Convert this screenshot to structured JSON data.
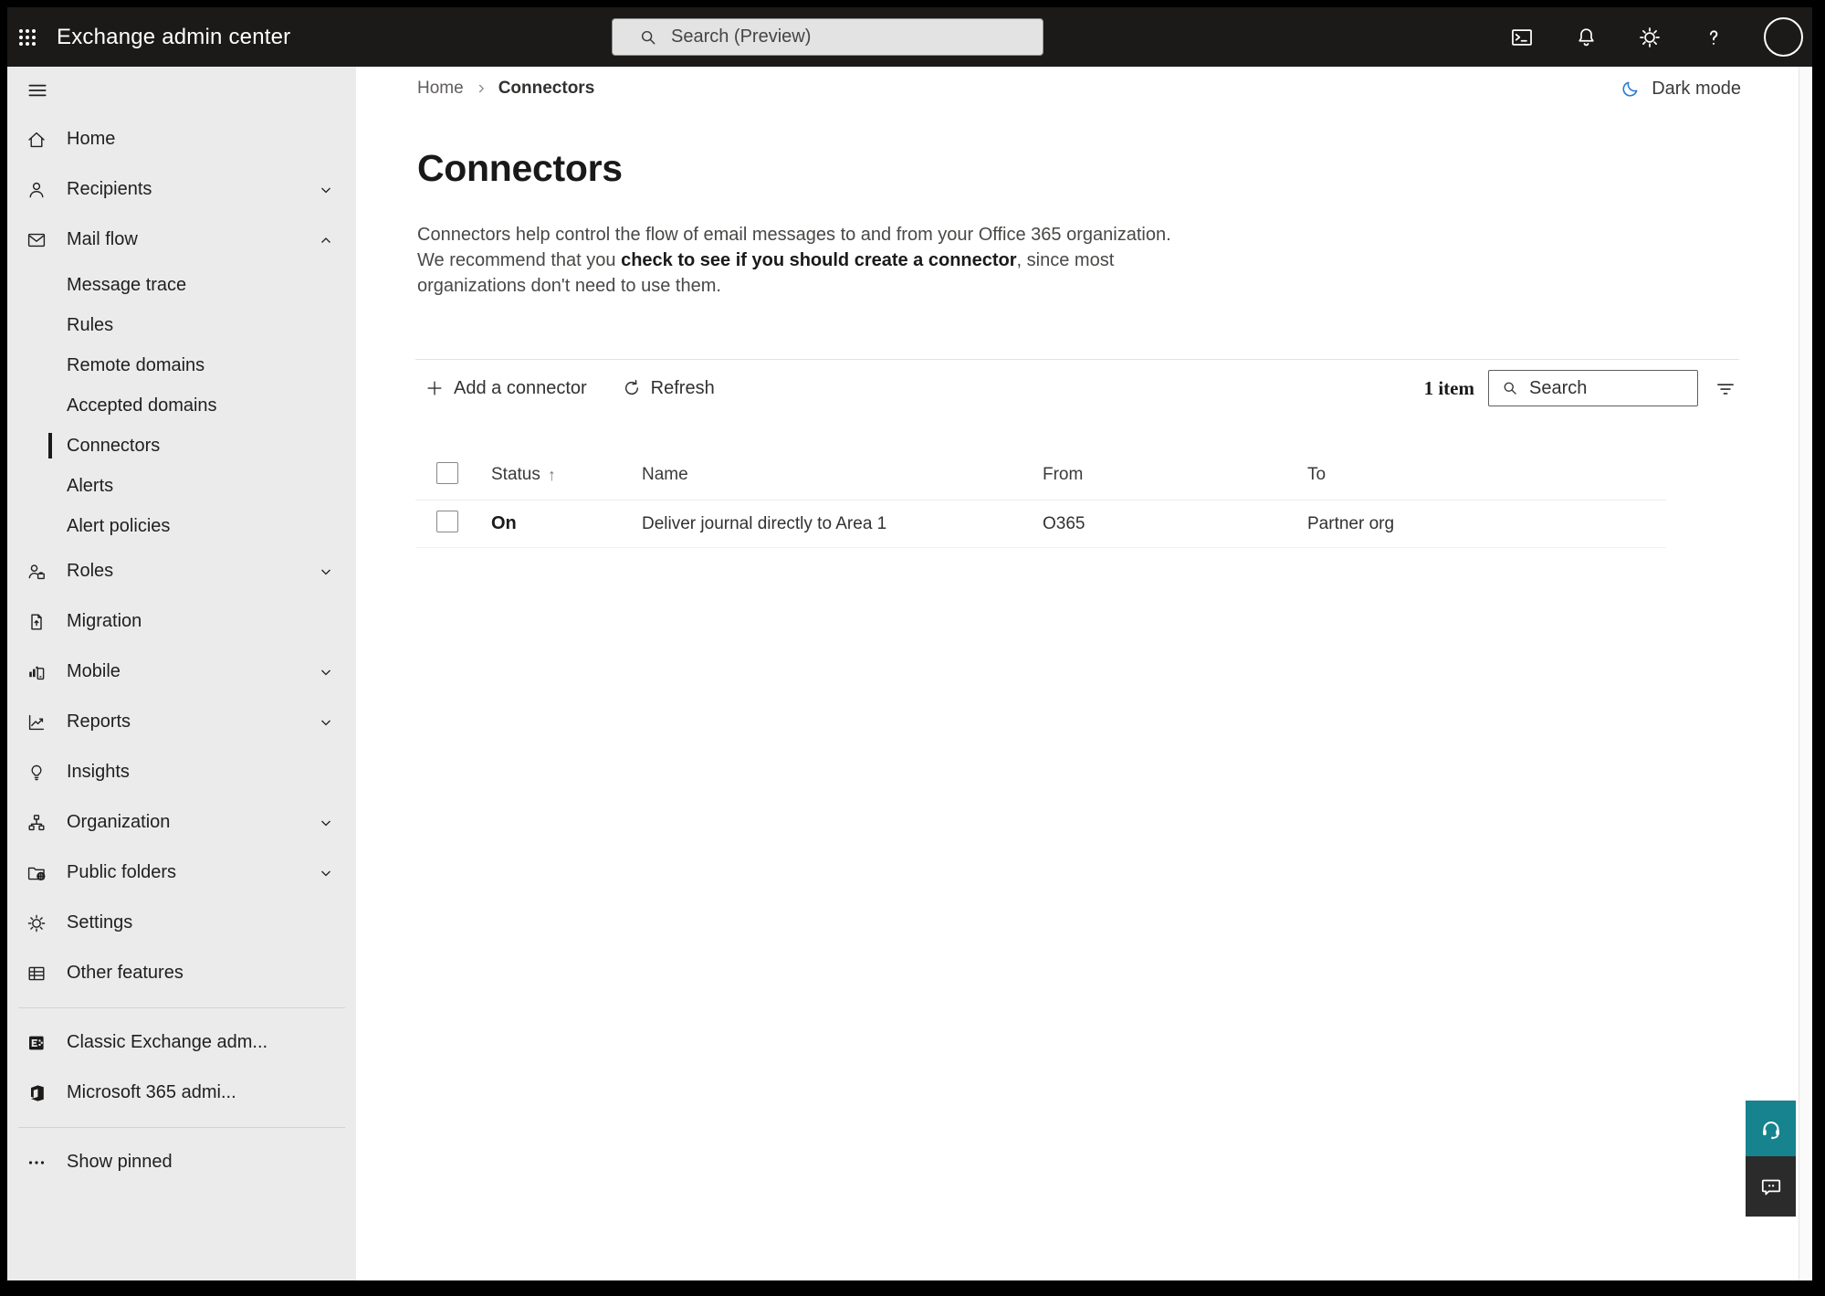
{
  "colors": {
    "topbar_bg": "#1b1a19",
    "sidebar_bg": "#ebebeb",
    "accent_blue": "#2b7cd3",
    "help_button_teal": "#16838e",
    "feedback_button_dark": "#2b2b2b",
    "selected_marker": "#1b1a19"
  },
  "topbar": {
    "title": "Exchange admin center",
    "search_placeholder": "Search (Preview)",
    "icons": [
      "app-launcher",
      "powershell-terminal",
      "notifications-bell",
      "settings-gear",
      "help-question",
      "account-avatar"
    ]
  },
  "sidebar": {
    "items": [
      {
        "label": "Home",
        "icon": "home"
      },
      {
        "label": "Recipients",
        "icon": "person",
        "chevron": "down"
      },
      {
        "label": "Mail flow",
        "icon": "mail",
        "chevron": "up",
        "expanded": true
      },
      {
        "label": "Roles",
        "icon": "person-badge",
        "chevron": "down"
      },
      {
        "label": "Migration",
        "icon": "document-arrow"
      },
      {
        "label": "Mobile",
        "icon": "mobile-chart",
        "chevron": "down"
      },
      {
        "label": "Reports",
        "icon": "line-chart",
        "chevron": "down"
      },
      {
        "label": "Insights",
        "icon": "lightbulb"
      },
      {
        "label": "Organization",
        "icon": "org-chart",
        "chevron": "down"
      },
      {
        "label": "Public folders",
        "icon": "folder-globe",
        "chevron": "down"
      },
      {
        "label": "Settings",
        "icon": "gear"
      },
      {
        "label": "Other features",
        "icon": "table-grid"
      }
    ],
    "mail_flow_children": [
      {
        "label": "Message trace"
      },
      {
        "label": "Rules"
      },
      {
        "label": "Remote domains"
      },
      {
        "label": "Accepted domains"
      },
      {
        "label": "Connectors",
        "selected": true
      },
      {
        "label": "Alerts"
      },
      {
        "label": "Alert policies"
      }
    ],
    "footer_links": [
      {
        "label": "Classic Exchange adm...",
        "icon": "exchange-logo"
      },
      {
        "label": "Microsoft 365 admi...",
        "icon": "microsoft-365-logo"
      }
    ],
    "show_pinned_label": "Show pinned"
  },
  "breadcrumb": {
    "items": [
      "Home",
      "Connectors"
    ]
  },
  "dark_mode": {
    "label": "Dark mode",
    "icon": "moon"
  },
  "page": {
    "title": "Connectors",
    "description_before": "Connectors help control the flow of email messages to and from your Office 365 organization. We recommend that you ",
    "description_link": "check to see if you should create a connector",
    "description_after": ", since most organizations don't need to use them."
  },
  "toolbar": {
    "add_label": "Add a connector",
    "refresh_label": "Refresh",
    "item_count": "1 item",
    "search_placeholder": "Search"
  },
  "table": {
    "columns": [
      "Status",
      "Name",
      "From",
      "To"
    ],
    "sort_indicator": "↑",
    "sort": {
      "column": "Status",
      "direction": "ascending"
    },
    "rows": [
      {
        "selected": false,
        "status": "On",
        "name": "Deliver journal directly to Area 1",
        "from": "O365",
        "to": "Partner org"
      }
    ]
  }
}
